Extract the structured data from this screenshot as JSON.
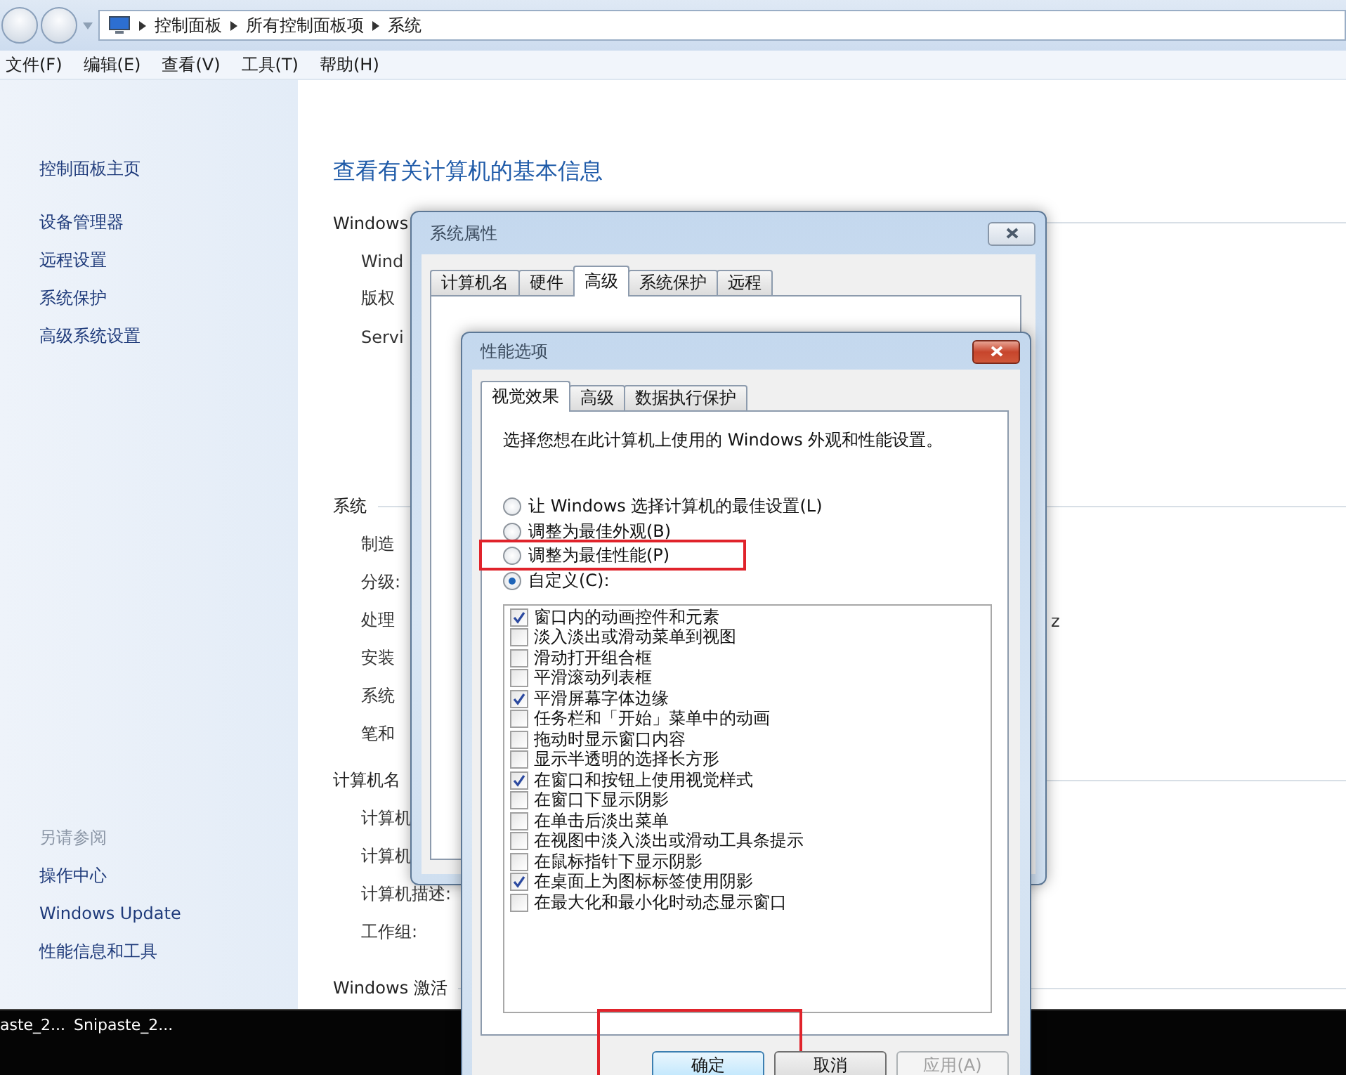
{
  "explorer": {
    "breadcrumb": [
      "控制面板",
      "所有控制面板项",
      "系统"
    ],
    "menu": [
      "文件(F)",
      "编辑(E)",
      "查看(V)",
      "工具(T)",
      "帮助(H)"
    ],
    "sidebar": {
      "home": "控制面板主页",
      "links": [
        "设备管理器",
        "远程设置",
        "系统保护",
        "高级系统设置"
      ],
      "see_also_title": "另请参阅",
      "see_also": [
        "操作中心",
        "Windows Update",
        "性能信息和工具"
      ]
    },
    "main": {
      "heading": "查看有关计算机的基本信息",
      "sections": [
        {
          "title": "Windows",
          "rows": [
            {
              "label": "Wind"
            },
            {
              "label": "版权"
            },
            {
              "label": "Servi"
            }
          ]
        },
        {
          "title": "系统",
          "rows": [
            {
              "label": "制造"
            },
            {
              "label": "分级:"
            },
            {
              "label": "处理",
              "value": "z"
            },
            {
              "label": "安装"
            },
            {
              "label": "系统"
            },
            {
              "label": "笔和"
            }
          ]
        },
        {
          "title": "计算机名",
          "rows": [
            {
              "label": "计算机"
            },
            {
              "label": "计算机"
            },
            {
              "label": "计算机描述:"
            },
            {
              "label": "工作组:"
            }
          ]
        },
        {
          "title": "Windows 激活"
        }
      ]
    }
  },
  "taskbar": {
    "items": [
      "aste_2...",
      "Snipaste_2..."
    ]
  },
  "system_properties": {
    "title": "系统属性",
    "tabs": [
      {
        "label": "计算机名",
        "selected": false
      },
      {
        "label": "硬件",
        "selected": false
      },
      {
        "label": "高级",
        "selected": true
      },
      {
        "label": "系统保护",
        "selected": false
      },
      {
        "label": "远程",
        "selected": false
      }
    ]
  },
  "performance_options": {
    "title": "性能选项",
    "tabs": [
      {
        "label": "视觉效果",
        "selected": true
      },
      {
        "label": "高级",
        "selected": false
      },
      {
        "label": "数据执行保护",
        "selected": false
      }
    ],
    "description": "选择您想在此计算机上使用的 Windows 外观和性能设置。",
    "options": [
      {
        "label": "让 Windows 选择计算机的最佳设置(L)",
        "selected": false,
        "highlighted": false
      },
      {
        "label": "调整为最佳外观(B)",
        "selected": false,
        "highlighted": false
      },
      {
        "label": "调整为最佳性能(P)",
        "selected": false,
        "highlighted": true
      },
      {
        "label": "自定义(C):",
        "selected": true,
        "highlighted": false
      }
    ],
    "effects": [
      {
        "label": "窗口内的动画控件和元素",
        "checked": true
      },
      {
        "label": "淡入淡出或滑动菜单到视图",
        "checked": false
      },
      {
        "label": "滑动打开组合框",
        "checked": false
      },
      {
        "label": "平滑滚动列表框",
        "checked": false
      },
      {
        "label": "平滑屏幕字体边缘",
        "checked": true
      },
      {
        "label": "任务栏和「开始」菜单中的动画",
        "checked": false
      },
      {
        "label": "拖动时显示窗口内容",
        "checked": false
      },
      {
        "label": "显示半透明的选择长方形",
        "checked": false
      },
      {
        "label": "在窗口和按钮上使用视觉样式",
        "checked": true
      },
      {
        "label": "在窗口下显示阴影",
        "checked": false
      },
      {
        "label": "在单击后淡出菜单",
        "checked": false
      },
      {
        "label": "在视图中淡入淡出或滑动工具条提示",
        "checked": false
      },
      {
        "label": "在鼠标指针下显示阴影",
        "checked": false
      },
      {
        "label": "在桌面上为图标标签使用阴影",
        "checked": true
      },
      {
        "label": "在最大化和最小化时动态显示窗口",
        "checked": false
      }
    ],
    "buttons": [
      {
        "label": "确定",
        "default": true,
        "disabled": false,
        "highlighted": true
      },
      {
        "label": "取消",
        "default": false,
        "disabled": false,
        "highlighted": false
      },
      {
        "label": "应用(A)",
        "default": false,
        "disabled": true,
        "highlighted": false
      }
    ]
  }
}
